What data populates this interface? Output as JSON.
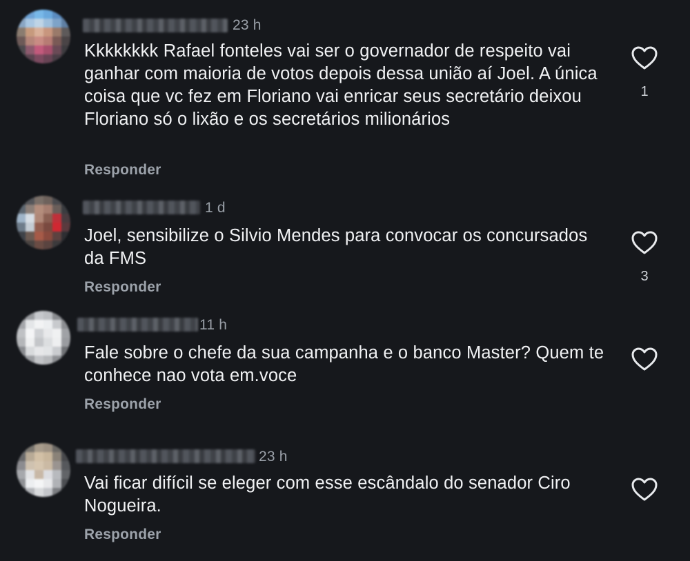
{
  "comments": [
    {
      "time": "23 h",
      "text": "Kkkkkkkk Rafael fonteles vai ser o governador de respeito vai ganhar com maioria de votos depois dessa união aí Joel. A única coisa que vc fez em Floriano vai enricar seus secretário deixou Floriano só o lixão e os secretários milionários",
      "reply_label": "Responder",
      "likes": "1",
      "like_icon": "heart-outline-icon"
    },
    {
      "time": "1 d",
      "text": "Joel, sensibilize o Silvio Mendes para convocar os concursados da FMS",
      "reply_label": "Responder",
      "likes": "3",
      "like_icon": "heart-outline-icon"
    },
    {
      "time": "11 h",
      "text": "Fale sobre o chefe da sua campanha e o banco Master? Quem te conhece nao vota em.voce",
      "reply_label": "Responder",
      "likes": "",
      "like_icon": "heart-outline-icon"
    },
    {
      "time": "23 h",
      "text": "Vai ficar difícil se eleger com esse escândalo do senador Ciro Nogueira.",
      "reply_label": "Responder",
      "likes": "",
      "like_icon": "heart-outline-icon"
    }
  ],
  "colors": {
    "background": "#16181c",
    "text": "#f1f2f4",
    "muted": "#9ca2aa"
  }
}
